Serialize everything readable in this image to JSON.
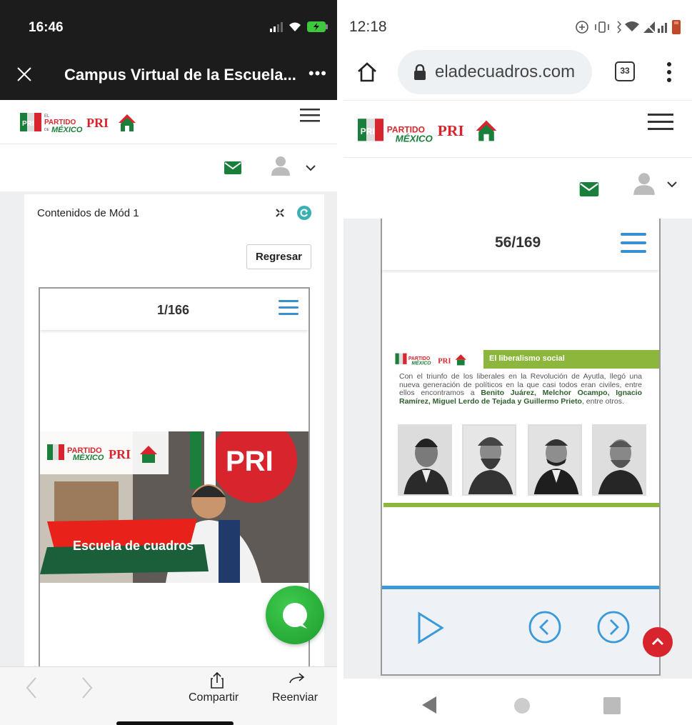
{
  "left": {
    "status": {
      "time": "16:46"
    },
    "appbar": {
      "title": "Campus Virtual de la Escuela...",
      "more": "•••"
    },
    "card": {
      "title": "Contenidos de Mód 1",
      "back_label": "Regresar"
    },
    "viewer": {
      "pager": "1/166",
      "slide_caption": "Escuela de cuadros"
    },
    "bottom": {
      "share_label": "Compartir",
      "forward_label": "Reenviar"
    }
  },
  "right": {
    "status": {
      "time": "12:18"
    },
    "browser": {
      "url": "eladecuadros.com",
      "tab_count": "33"
    },
    "viewer": {
      "pager": "56/169",
      "slide_title": "El liberalismo social",
      "slide_text_plain": "Con el triunfo de los liberales en la Revolución de Ayutla, llegó una nueva generación de políticos en la que casi todos eran civiles, entre ellos encontramos a ",
      "slide_text_bold": "Benito Juárez, Melchor Ocampo, Ignacio Ramírez, Miguel Lerdo de Tejada y Guillermo Prieto",
      "slide_text_end": ", entre otros."
    }
  },
  "brand": {
    "logo_partido_top": "PARTIDO",
    "logo_partido_bottom": "MÉXICO",
    "logo_pri": "PRI",
    "logo_el": "EL",
    "logo_de": "DE"
  },
  "colors": {
    "dark_bar": "#1c1c1c",
    "accent_blue": "#3a8fd1",
    "pri_green": "#1a7f3a",
    "pri_red": "#d8252d",
    "slide_green": "#8cb63c"
  }
}
